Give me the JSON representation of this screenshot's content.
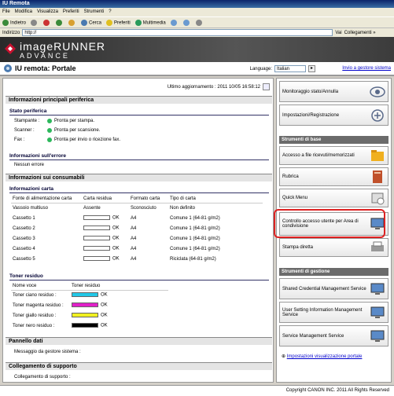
{
  "window": {
    "title": "IU Remota"
  },
  "menu": [
    "File",
    "Modifica",
    "Visualizza",
    "Preferiti",
    "Strumenti",
    "?"
  ],
  "toolbar": {
    "back": "Indietro",
    "search": "Cerca",
    "favorites": "Preferiti",
    "multimedia": "Multimedia"
  },
  "address": {
    "label": "Indirizzo",
    "value": "http://",
    "go": "Vai",
    "links": "Collegamenti »"
  },
  "brand": {
    "line1": "imageRUNNER",
    "line2": "ADVANCE"
  },
  "header": {
    "title": "IU remota: Portale",
    "language_label": "Language:",
    "language_value": "Italian",
    "send_link": "Invio a gestore sistema"
  },
  "update": {
    "text": "Ultimo aggiornamento : 2011 10/05 16:58:12"
  },
  "sections": {
    "main_info": "Informazioni principali periferica",
    "device_status": "Stato periferica",
    "error_info": "Informazioni sull'errore",
    "consumables": "Informazioni sui consumabili",
    "paper_info": "Informazioni carta",
    "toner": "Toner residuo",
    "data_panel": "Pannello dati",
    "support_link": "Collegamento di supporto"
  },
  "status": [
    {
      "label": "Stampante :",
      "value": "Pronta per stampa."
    },
    {
      "label": "Scanner :",
      "value": "Pronta per scansione."
    },
    {
      "label": "Fax :",
      "value": "Pronta per invio o ricezione fax."
    }
  ],
  "error": {
    "value": "Nessun errore"
  },
  "paper": {
    "headers": [
      "Fonte di alimentazione carta",
      "Carta residua",
      "Formato carta",
      "Tipo di carta"
    ],
    "rows": [
      {
        "source": "Vassoio multiuso",
        "remaining": "Assente",
        "level": null,
        "size": "Sconosciuto",
        "type": "Non definito"
      },
      {
        "source": "Cassetto 1",
        "remaining": "OK",
        "level": 0,
        "size": "A4",
        "type": "Comune 1 (64-81 g/m2)"
      },
      {
        "source": "Cassetto 2",
        "remaining": "OK",
        "level": 0,
        "size": "A4",
        "type": "Comune 1 (64-81 g/m2)"
      },
      {
        "source": "Cassetto 3",
        "remaining": "OK",
        "level": 0,
        "size": "A4",
        "type": "Comune 1 (64-81 g/m2)"
      },
      {
        "source": "Cassetto 4",
        "remaining": "OK",
        "level": 0,
        "size": "A4",
        "type": "Comune 1 (64-81 g/m2)"
      },
      {
        "source": "Cassetto 5",
        "remaining": "OK",
        "level": 0,
        "size": "A4",
        "type": "Riciclata (64-81 g/m2)"
      }
    ]
  },
  "toner": {
    "headers": [
      "Nome voce",
      "Toner residuo"
    ],
    "rows": [
      {
        "name": "Toner ciano residuo :",
        "color": "#22c8e8",
        "status": "OK"
      },
      {
        "name": "Toner magenta residuo :",
        "color": "#e020c8",
        "status": "OK"
      },
      {
        "name": "Toner giallo residuo :",
        "color": "#f0f020",
        "status": "OK"
      },
      {
        "name": "Toner nero residuo :",
        "color": "#000000",
        "status": "OK"
      }
    ]
  },
  "data_panel": {
    "label": "Messaggio da gestore sistema :"
  },
  "support": {
    "label": "Collegamento di supporto :"
  },
  "side": {
    "monitor": "Monitoraggio stato/Annulla",
    "settings": "Impostazioni/Registrazione",
    "basic_title": "Strumenti di base",
    "received_files": "Accesso a file ricevuti/memorizzati",
    "address_book": "Rubrica",
    "quick_menu": "Quick Menu",
    "access_control": "Controllo accesso utente per Area di condivisione",
    "direct_print": "Stampa diretta",
    "mgmt_title": "Strumenti di gestione",
    "shared_cred": "Shared Credential Management Service",
    "user_setting": "User Setting Information Management Service",
    "service_mgmt": "Service Management Service",
    "portal_settings": "Impostazioni visualizzazione portale"
  },
  "footer": {
    "copyright": "Copyright CANON INC. 2011 All Rights Reserved"
  }
}
